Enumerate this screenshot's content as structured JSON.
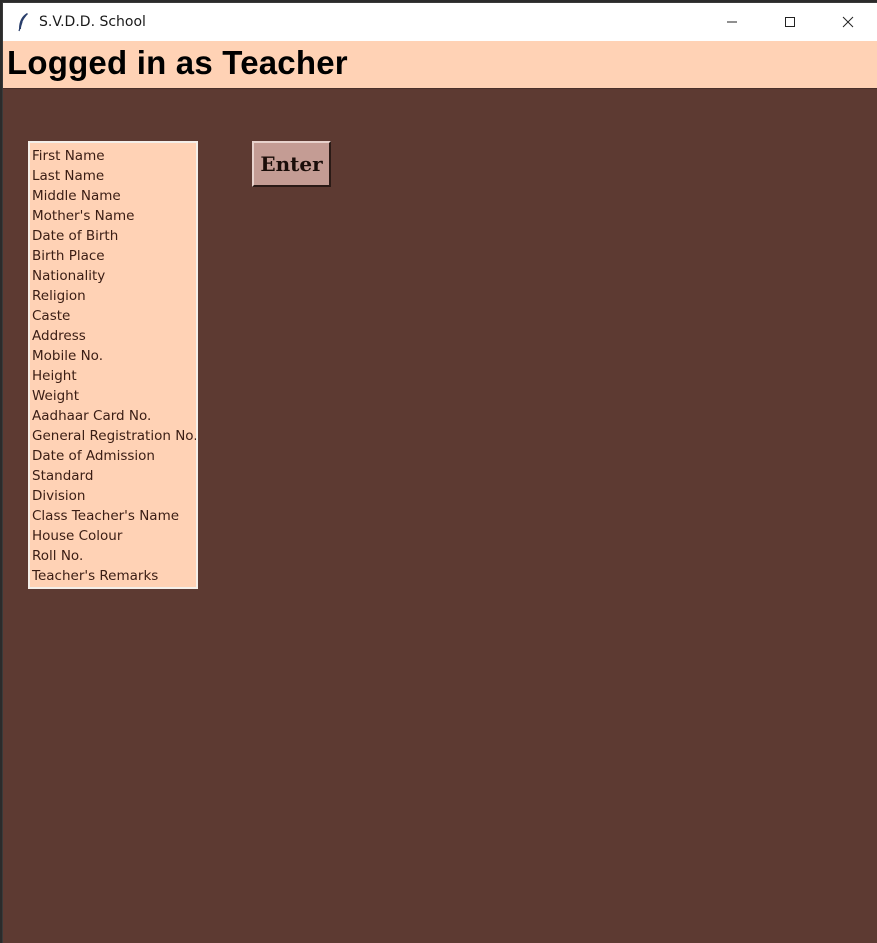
{
  "window": {
    "title": "S.V.D.D. School",
    "app_icon": "feather-icon",
    "controls": [
      "minimize-icon",
      "maximize-icon",
      "close-icon"
    ]
  },
  "header": {
    "title": "Logged in as Teacher"
  },
  "fields_list": {
    "items": [
      "First Name",
      "Last Name",
      "Middle Name",
      "Mother's Name",
      "Date of Birth",
      "Birth Place",
      "Nationality",
      "Religion",
      "Caste",
      "Address",
      "Mobile No.",
      "Height",
      "Weight",
      "Aadhaar Card No.",
      "General Registration No.",
      "Date of Admission",
      "Standard",
      "Division",
      "Class Teacher's Name",
      "House Colour",
      "Roll No.",
      "Teacher's Remarks"
    ]
  },
  "actions": {
    "enter_label": "Enter"
  },
  "colors": {
    "background": "#5d3a32",
    "header_bg": "#ffd2b5",
    "list_bg": "#ffd2b5",
    "button_bg": "#c49c94"
  }
}
